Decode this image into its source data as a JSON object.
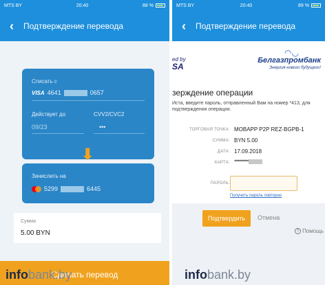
{
  "left": {
    "status": {
      "carrier": "MTS BY",
      "time": "20:40",
      "battery": "88 %"
    },
    "nav": {
      "back_icon": "chevron-left-icon",
      "title": "Подтверждение перевода"
    },
    "from_card": {
      "label": "Списать с",
      "brand": "VISA",
      "number_start": "4641",
      "number_end": "0657",
      "valid_label": "Действует до",
      "valid_value": "09/23",
      "cvv_label": "CVV2/CVC2",
      "cvv_value": "•••"
    },
    "to_card": {
      "label": "Зачислить на",
      "number_start": "5299",
      "number_end": "6445"
    },
    "sum": {
      "label": "Сумма",
      "value": "5.00 BYN"
    },
    "submit_label": "Сделать перевод"
  },
  "right": {
    "status": {
      "carrier": "MTS BY",
      "time": "20:40",
      "battery": "89 %"
    },
    "nav": {
      "back_icon": "chevron-left-icon",
      "title": "Подтверждение перевода"
    },
    "vbv": {
      "line1": "ed by",
      "line2": "SA"
    },
    "bank": {
      "name": "Белгазпромбанк",
      "tagline": "Энергия нового будущего!"
    },
    "heading": "зерждение операции",
    "description": "Иста, введите пароль, отправленный Вам на номер *413, для подтверждения операции.",
    "merchant_label": "ТОРГОВАЯ ТОЧКА:",
    "merchant_value": "MOBAPP P2P REZ-BGPB-1",
    "amount_label": "СУММА:",
    "amount_value": "BYN 5.00",
    "date_label": "ДАТА:",
    "date_value": "17.09.2018",
    "card_label": "КАРТА:",
    "card_value": "************",
    "password_label": "ПАРОЛЬ:",
    "password_value": "",
    "resend_label": "Получить пароль повторно",
    "confirm_label": "Подтвердить",
    "cancel_label": "Отмена",
    "help_label": "Помощь"
  },
  "watermark": {
    "bold": "info",
    "light": "bank.by"
  },
  "colors": {
    "header_blue": "#1d8fdc",
    "card_blue": "#2a86c7",
    "accent_orange": "#f0a21e"
  }
}
